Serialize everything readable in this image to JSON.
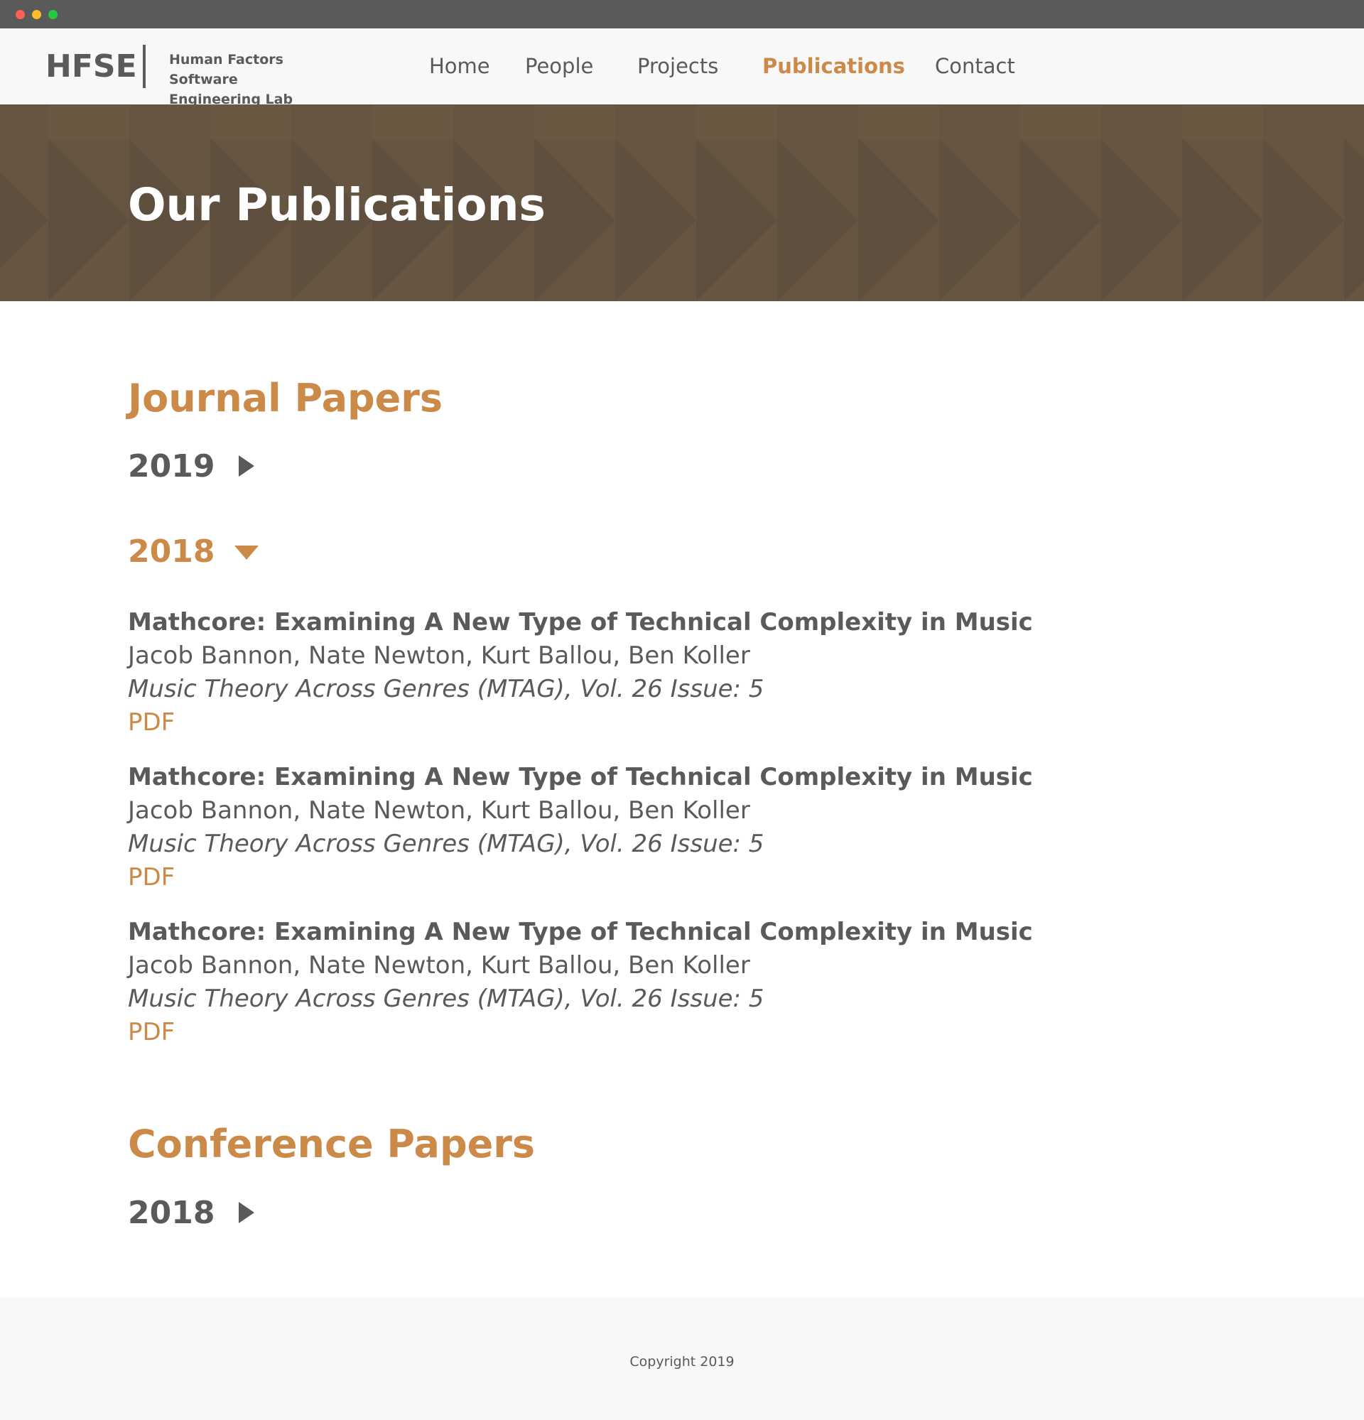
{
  "header": {
    "brand": "HFSE",
    "subtitle_line1": "Human Factors Software",
    "subtitle_line2": "Engineering Lab",
    "nav": [
      "Home",
      "People",
      "Projects",
      "Publications",
      "Contact"
    ],
    "active_nav": "Publications"
  },
  "hero": {
    "title": "Our Publications"
  },
  "journal": {
    "heading": "Journal Papers",
    "years": [
      {
        "label": "2019",
        "expanded": false
      },
      {
        "label": "2018",
        "expanded": true
      }
    ],
    "papers": [
      {
        "title": "Mathcore: Examining A New Type of Technical Complexity in Music",
        "authors": "Jacob Bannon, Nate Newton, Kurt Ballou, Ben Koller",
        "venue": "Music Theory Across Genres (MTAG), Vol. 26 Issue: 5",
        "link": "PDF"
      },
      {
        "title": "Mathcore: Examining A New Type of Technical Complexity in Music",
        "authors": "Jacob Bannon, Nate Newton, Kurt Ballou, Ben Koller",
        "venue": "Music Theory Across Genres (MTAG), Vol. 26 Issue: 5",
        "link": "PDF"
      },
      {
        "title": "Mathcore: Examining A New Type of Technical Complexity in Music",
        "authors": "Jacob Bannon, Nate Newton, Kurt Ballou, Ben Koller",
        "venue": "Music Theory Across Genres (MTAG), Vol. 26 Issue: 5",
        "link": "PDF"
      }
    ]
  },
  "conference": {
    "heading": "Conference Papers",
    "years": [
      {
        "label": "2018",
        "expanded": false
      }
    ]
  },
  "footer": {
    "copyright": "Copyright 2019"
  },
  "colors": {
    "accent": "#cc8a48",
    "text": "#5a5a5a",
    "hero_bg": "#665541",
    "chrome": "#5a5a5a",
    "header_bg": "#f8f8f8"
  },
  "icons": {
    "collapsed": "caret-right-icon",
    "expanded": "caret-down-icon"
  }
}
